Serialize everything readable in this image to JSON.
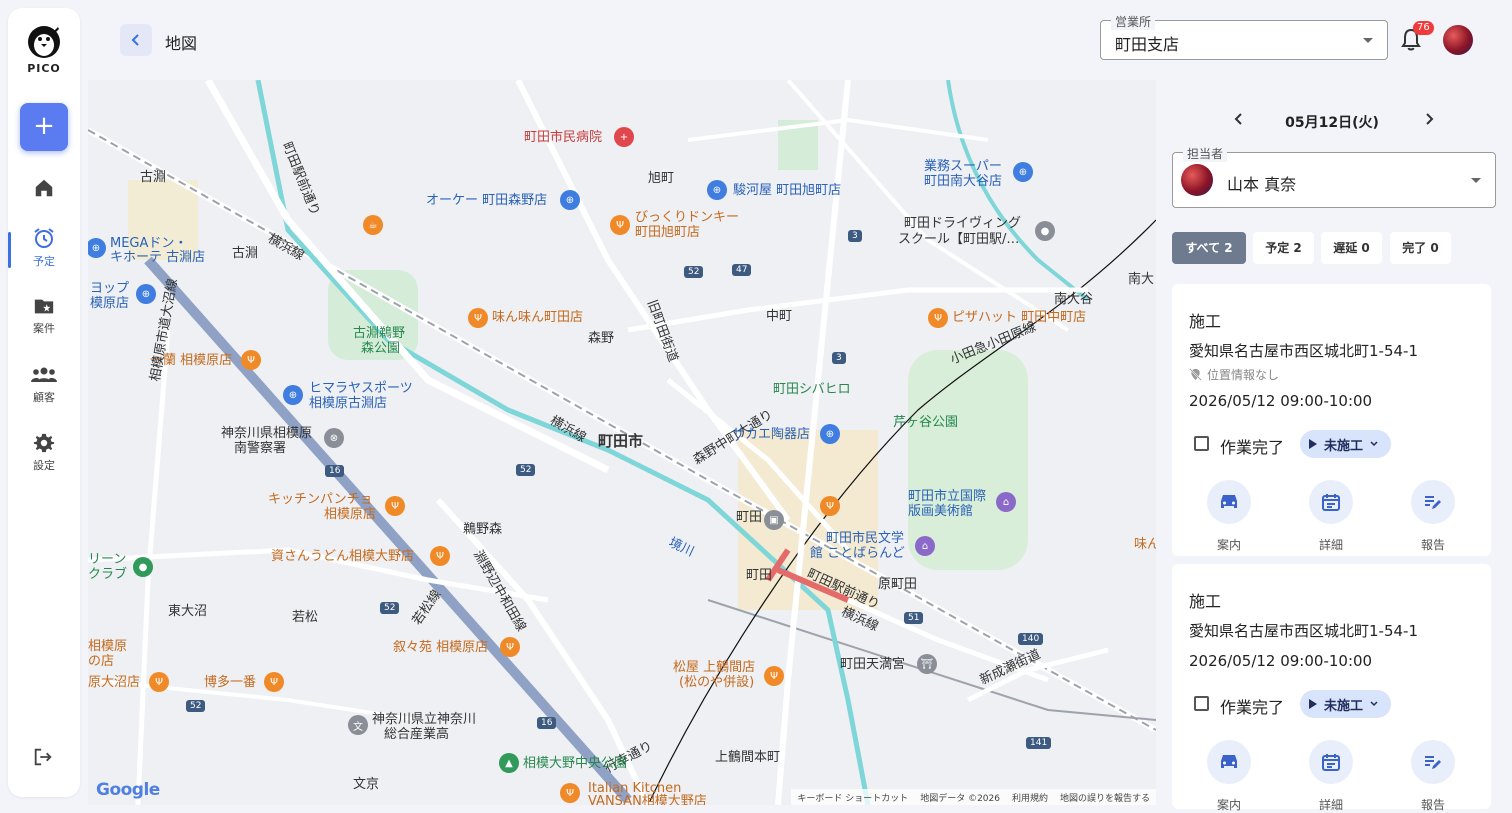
{
  "app": {
    "logo_text": "PICO"
  },
  "sidebar": {
    "add_label": "+",
    "items": [
      {
        "label": "",
        "icon": "home-icon"
      },
      {
        "label": "予定",
        "icon": "alarm-clock-icon",
        "active": true
      },
      {
        "label": "案件",
        "icon": "folder-star-icon"
      },
      {
        "label": "顧客",
        "icon": "group-icon"
      },
      {
        "label": "設定",
        "icon": "gear-icon"
      }
    ]
  },
  "header": {
    "title": "地図",
    "office_label": "営業所",
    "office_value": "町田支店",
    "notification_count": "76"
  },
  "map": {
    "labels": {
      "a1": "町田市民病院",
      "a2": "旭町",
      "a3": "オーケー 町田森野店",
      "a4": "駿河屋 町田旭町店",
      "a5": "びっくりドンキー",
      "a6": "町田旭町店",
      "a7": "業務スーパー",
      "a8": "町田南大谷店",
      "a9": "町田ドライヴィング",
      "a10": "スクール【町田駅/…",
      "a11": "古淵",
      "a12": "MEGAドン・",
      "a13": "キホーテ 古淵店",
      "a14": "古淵",
      "a15": "ヨップ",
      "a16": "模原店",
      "a17": "町田駅前通り",
      "a18": "横浜線",
      "a19": "味ん味ん町田店",
      "a20": "森野",
      "a21": "旧町田街道",
      "a22": "中町",
      "a23": "ピザハット 町田中町店",
      "a24": "南大谷",
      "a25": "小田急小田原線",
      "a26": "古淵鵜野",
      "a27": "森公園",
      "a28": "一蘭 相模原店",
      "a29": "ヒマラヤスポーツ",
      "a30": "相模原古淵店",
      "a31": "町田シバヒロ",
      "a32": "芹ヶ谷公園",
      "a33": "森野中町大通り",
      "a34": "町田市",
      "a35": "神奈川県相模原",
      "a36": "南警察署",
      "a37": "サカエ陶器店",
      "a38": "横浜線",
      "a39": "相模原市道大沼線",
      "a40": "キッチンパンチョ",
      "a41": "相模原店",
      "a42": "町田",
      "a43": "町田市立国際",
      "a44": "版画美術館",
      "a45": "鵜野森",
      "a46": "資さんうどん相模大野店",
      "a47": "境川",
      "a48": "町田市民文学",
      "a49": "館 ことばらんど",
      "a50": "リーン",
      "a51": "クラブ",
      "a52": "淵野辺中和田線",
      "a53": "町田",
      "a54": "町田駅前通り",
      "a55": "原町田",
      "a56": "東大沼",
      "a57": "若松",
      "a58": "若松線",
      "a59": "横浜線",
      "a60": "相模原",
      "a61": "の店",
      "a62": "叙々苑 相模原店",
      "a63": "松屋 上鶴間店",
      "a64": "(松のや併設)",
      "a65": "町田天満宮",
      "a66": "新成瀬街道",
      "a67": "原大沼店",
      "a68": "博多一番",
      "a69": "神奈川県立神奈川",
      "a70": "総合産業高",
      "a71": "行幸通り",
      "a72": "上鶴間本町",
      "a73": "相模大野中央公園",
      "a74": "文京",
      "a75": "Italian Kitchen",
      "a76": "VANSAN相模大野店",
      "a77": "南大",
      "a78": "味ん"
    },
    "road_numbers": [
      "52",
      "47",
      "3",
      "3",
      "16",
      "52",
      "52",
      "16",
      "51",
      "140",
      "141",
      "52"
    ],
    "google_logo": "Google",
    "footer": [
      "キーボード ショートカット",
      "地図データ ©2026",
      "利用規約",
      "地図の誤りを報告する"
    ]
  },
  "panel": {
    "date": "05月12日(火)",
    "staff_label": "担当者",
    "staff_name": "山本 真奈",
    "filters": [
      {
        "label": "すべて 2",
        "active": true
      },
      {
        "label": "予定 2"
      },
      {
        "label": "遅延 0"
      },
      {
        "label": "完了 0"
      }
    ],
    "cards": [
      {
        "type": "施工",
        "address": "愛知県名古屋市西区城北町1-54-1",
        "location_note": "位置情報なし",
        "time": "2026/05/12 09:00-10:00",
        "check_label": "作業完了",
        "status": "未施工",
        "actions": [
          "案内",
          "詳細",
          "報告"
        ]
      },
      {
        "type": "施工",
        "address": "愛知県名古屋市西区城北町1-54-1",
        "time": "2026/05/12 09:00-10:00",
        "check_label": "作業完了",
        "status": "未施工",
        "actions": [
          "案内",
          "詳細",
          "報告"
        ]
      }
    ]
  },
  "colors": {
    "accent": "#5b7bf0",
    "nav_active": "#3b6fe3",
    "badge": "#ef3b3b",
    "chip": "#d8e4fb"
  }
}
